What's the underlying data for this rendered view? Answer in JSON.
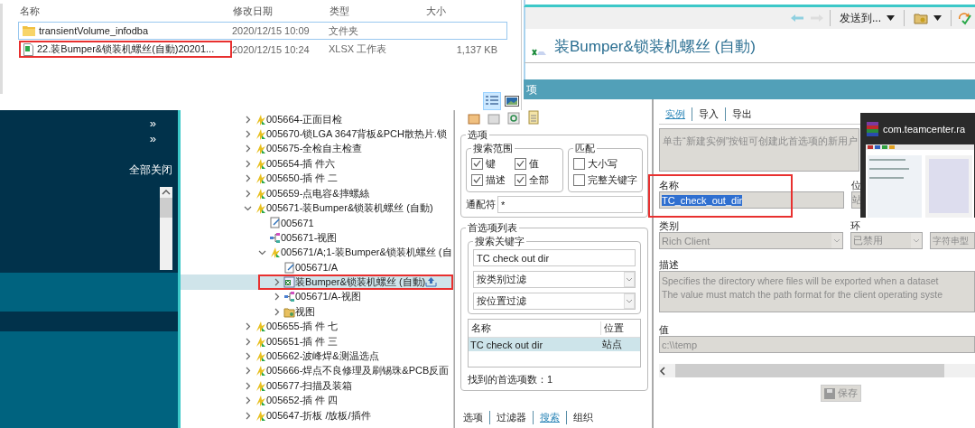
{
  "explorer": {
    "columns": [
      "名称",
      "修改日期",
      "类型",
      "大小"
    ],
    "rows": [
      {
        "kind": "folder",
        "name": "transientVolume_infodba",
        "date": "2020/12/15 10:09",
        "type": "文件夹",
        "focused": true,
        "highlighted": false
      },
      {
        "kind": "spreadsheet",
        "name": "22.装Bumper&锁装机螺丝(自動)20201...",
        "date": "2020/12/15 10:24",
        "type": "XLSX 工作表",
        "size": "1,137 KB",
        "focused": false,
        "highlighted": true
      }
    ],
    "views": [
      {
        "kind": "details",
        "selected": true
      },
      {
        "kind": "large",
        "selected": false
      }
    ]
  },
  "toolbar": {
    "send_to": "发送到..."
  },
  "title": "装Bumper&锁装机螺丝 (自動)",
  "view_bar": {
    "label": "项"
  },
  "left_panel": {
    "chevrons": [
      "»",
      "»"
    ],
    "close_all": "全部关闭"
  },
  "tree": [
    {
      "label": "005664-正面目检",
      "kind": "item",
      "has_children": true,
      "expanded": false,
      "selected": false,
      "highlighted": false
    },
    {
      "label": "005670-锁LGA 3647背板&PCH散热片.锁",
      "kind": "item",
      "has_children": true,
      "expanded": false,
      "selected": false,
      "highlighted": false
    },
    {
      "label": "005675-全检自主检查",
      "kind": "item",
      "has_children": true,
      "expanded": false,
      "selected": false,
      "highlighted": false
    },
    {
      "label": "005654-插 件六",
      "kind": "item",
      "has_children": true,
      "expanded": false,
      "selected": false,
      "highlighted": false
    },
    {
      "label": "005650-插 件 二",
      "kind": "item",
      "has_children": true,
      "expanded": false,
      "selected": false,
      "highlighted": false
    },
    {
      "label": "005659-点电容&摔螺絲",
      "kind": "item",
      "has_children": true,
      "expanded": false,
      "selected": false,
      "highlighted": false
    },
    {
      "label": "005671-装Bumper&锁装机螺丝 (自動)",
      "kind": "item",
      "has_children": true,
      "expanded": true,
      "selected": false,
      "highlighted": false,
      "children": [
        {
          "label": "005671",
          "kind": "document",
          "has_children": false,
          "expanded": false,
          "selected": false,
          "highlighted": false
        },
        {
          "label": "005671-视图",
          "kind": "view",
          "has_children": false,
          "expanded": false,
          "selected": false,
          "highlighted": false
        },
        {
          "label": "005671/A;1-装Bumper&锁装机螺丝 (自",
          "kind": "item",
          "has_children": true,
          "expanded": true,
          "selected": false,
          "highlighted": false,
          "children": [
            {
              "label": "005671/A",
              "kind": "document",
              "has_children": false,
              "expanded": false,
              "selected": false,
              "highlighted": false
            },
            {
              "label": "装Bumper&锁装机螺丝 (自動)",
              "kind": "dataset",
              "has_children": true,
              "expanded": false,
              "selected": true,
              "highlighted": true
            },
            {
              "label": "005671/A-视图",
              "kind": "view",
              "has_children": true,
              "expanded": false,
              "selected": false,
              "highlighted": false
            },
            {
              "label": "视图",
              "kind": "folder",
              "has_children": true,
              "expanded": false,
              "selected": false,
              "highlighted": false
            }
          ]
        }
      ]
    },
    {
      "label": "005655-插 件 七",
      "kind": "item",
      "has_children": true,
      "expanded": false,
      "selected": false,
      "highlighted": false
    },
    {
      "label": "005651-插 件 三",
      "kind": "item",
      "has_children": true,
      "expanded": false,
      "selected": false,
      "highlighted": false
    },
    {
      "label": "005662-波峰焊&测温选点",
      "kind": "item",
      "has_children": true,
      "expanded": false,
      "selected": false,
      "highlighted": false
    },
    {
      "label": "005666-焊点不良修理及刷锡珠&PCB反面",
      "kind": "item",
      "has_children": true,
      "expanded": false,
      "selected": false,
      "highlighted": false
    },
    {
      "label": "005677-扫描及装箱",
      "kind": "item",
      "has_children": true,
      "expanded": false,
      "selected": false,
      "highlighted": false
    },
    {
      "label": "005652-插 件 四",
      "kind": "item",
      "has_children": true,
      "expanded": false,
      "selected": false,
      "highlighted": false
    },
    {
      "label": "005647-折板 /放板/插件",
      "kind": "item",
      "has_children": true,
      "expanded": false,
      "selected": false,
      "highlighted": false
    }
  ],
  "search_panel": {
    "options": {
      "title": "选项",
      "scope": {
        "title": "搜索范围",
        "checks": [
          {
            "label": "键",
            "checked": true
          },
          {
            "label": "值",
            "checked": true
          },
          {
            "label": "描述",
            "checked": true
          },
          {
            "label": "全部",
            "checked": true
          }
        ]
      },
      "match": {
        "title": "匹配",
        "checks": [
          {
            "label": "大小写",
            "checked": false
          },
          {
            "label": "完整关键字",
            "checked": false
          }
        ]
      },
      "wildcard": {
        "label": "通配符",
        "value": "*"
      }
    },
    "list": {
      "title": "首选项列表",
      "keyword": {
        "title": "搜索关键字",
        "value": "TC check out dir"
      },
      "filters": [
        "按类别过滤",
        "按位置过滤"
      ],
      "columns": [
        "名称",
        "位置"
      ],
      "rows": [
        {
          "name": "TC check out dir",
          "location": "站点",
          "selected": true
        }
      ],
      "count": "找到的首选项数：1"
    },
    "tabs": [
      {
        "label": "选项",
        "selected": false
      },
      {
        "label": "过滤器",
        "selected": false
      },
      {
        "label": "搜索",
        "selected": true
      },
      {
        "label": "组织",
        "selected": false
      }
    ]
  },
  "detail_panel": {
    "tabs": [
      {
        "label": "实例",
        "selected": true
      },
      {
        "label": "导入",
        "selected": false
      },
      {
        "label": "导出",
        "selected": false
      }
    ],
    "info": "单击“新建实例”按钮可创建此首选项的新用户",
    "name": {
      "label": "名称",
      "value": "TC_check_out_dir",
      "text_selected": true,
      "highlighted": true,
      "disabled": true
    },
    "location": {
      "label": "位",
      "value": "站",
      "disabled": true
    },
    "category": {
      "label": "类别",
      "value": "Rich Client",
      "disabled": true
    },
    "environment": {
      "label": "环",
      "value": "已禁用",
      "disabled": true
    },
    "type": {
      "value": "字符串型",
      "disabled": true
    },
    "description": {
      "label": "描述",
      "lines": [
        "Specifies the directory where files will be exported when a dataset",
        "The value must match the path format for the client operating syste"
      ],
      "disabled": true
    },
    "value": {
      "label": "值",
      "value": "c:\\\\temp",
      "disabled": true
    },
    "save": {
      "label": "保存",
      "disabled": true
    }
  },
  "preview_popup": {
    "title": "com.teamcenter.ra",
    "kind": "picture"
  }
}
